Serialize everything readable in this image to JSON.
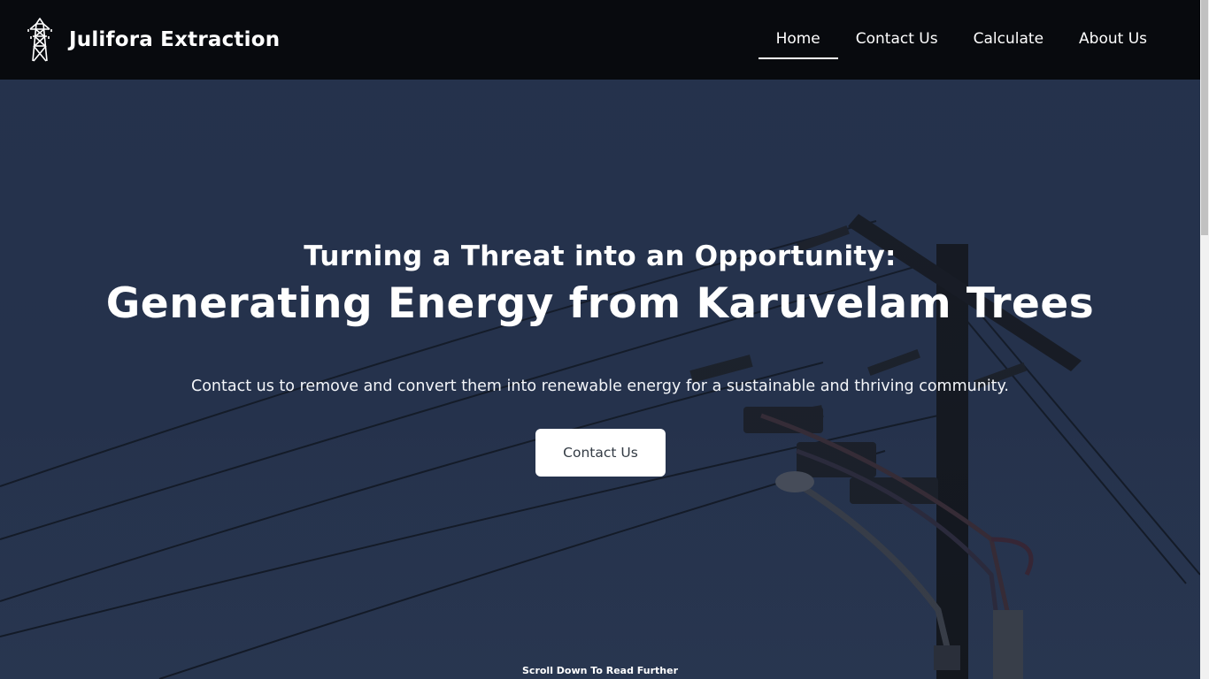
{
  "header": {
    "brand_name": "Julifora Extraction",
    "logo_icon": "transmission-tower-icon",
    "nav": [
      {
        "label": "Home",
        "active": true
      },
      {
        "label": "Contact Us",
        "active": false
      },
      {
        "label": "Calculate",
        "active": false
      },
      {
        "label": "About Us",
        "active": false
      }
    ]
  },
  "hero": {
    "subtitle": "Turning a Threat into an Opportunity:",
    "title": "Generating Energy from Karuvelam Trees",
    "description": "Contact us to remove and convert them into renewable energy for a sustainable and thriving community.",
    "cta_label": "Contact Us",
    "scroll_hint": "Scroll Down To Read Further"
  },
  "colors": {
    "header_bg": "#080a0e",
    "hero_sky": "#26324a",
    "text": "#ffffff",
    "button_bg": "#ffffff",
    "button_text": "#333b44"
  }
}
